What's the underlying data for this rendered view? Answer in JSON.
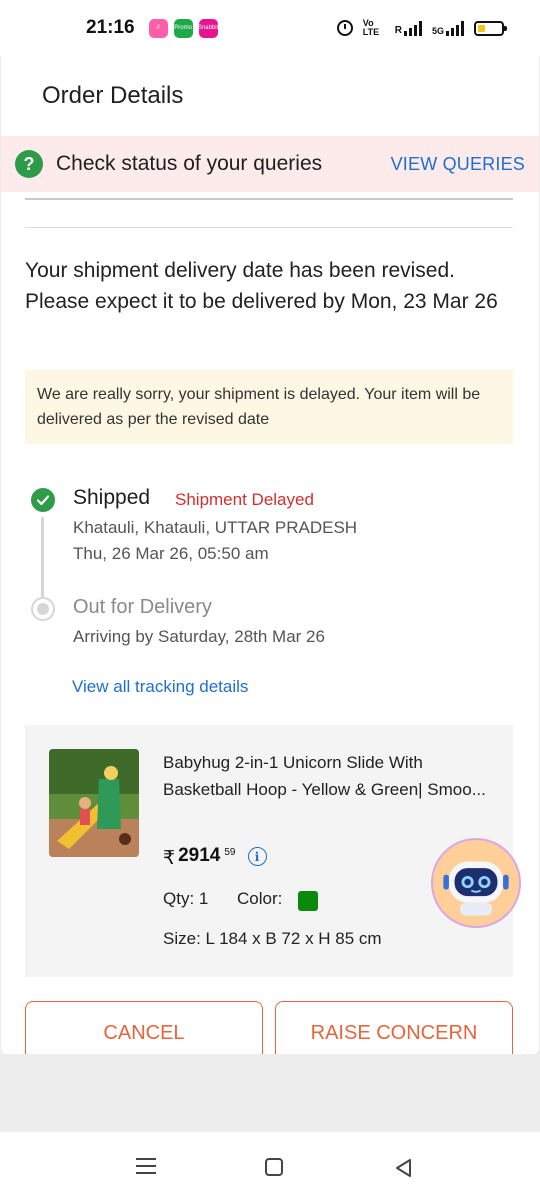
{
  "status_bar": {
    "time": "21:16",
    "apps": [
      {
        "name": "notes",
        "label": "//",
        "color": "#ff5ea8"
      },
      {
        "name": "promo",
        "label": "Promo",
        "color": "#1fa94a"
      },
      {
        "name": "snabbit",
        "label": "Snabbit",
        "color": "#e8138f"
      }
    ],
    "volte": "Vo LTE",
    "net": "R",
    "net_type": "5G"
  },
  "header": {
    "title": "Order Details"
  },
  "query_banner": {
    "text": "Check status of your queries",
    "link": "VIEW QUERIES",
    "icon": "?"
  },
  "revision": {
    "message": "Your shipment delivery date has been revised. Please expect it to be delivered by Mon, 23 Mar 26"
  },
  "delay_notice": {
    "message": "We are really sorry, your shipment is delayed. Your item will be delivered as per the revised date"
  },
  "tracking": {
    "steps": [
      {
        "status": "Shipped",
        "badge": "Shipment Delayed",
        "location": "Khatauli, Khatauli, UTTAR PRADESH",
        "time": "Thu, 26 Mar 26, 05:50 am"
      },
      {
        "status": "Out for Delivery",
        "detail": "Arriving by Saturday, 28th Mar 26"
      }
    ],
    "view_all": "View all tracking details"
  },
  "product": {
    "name": "Babyhug 2-in-1 Unicorn Slide With Basketball Hoop - Yellow & Green| Smoo...",
    "currency": "₹",
    "price": "2914",
    "price_decimal": "59",
    "qty": "Qty: 1",
    "color_label": "Color:",
    "color_value": "#0a8a0a",
    "size": "Size: L 184 x B 72 x H 85 cm"
  },
  "actions": {
    "cancel": "CANCEL",
    "raise": "RAISE CONCERN"
  },
  "colors": {
    "accent_orange": "#e8643c",
    "link_blue": "#1e6fd0",
    "success_green": "#2e9b48",
    "error_red": "#d32f2f"
  }
}
